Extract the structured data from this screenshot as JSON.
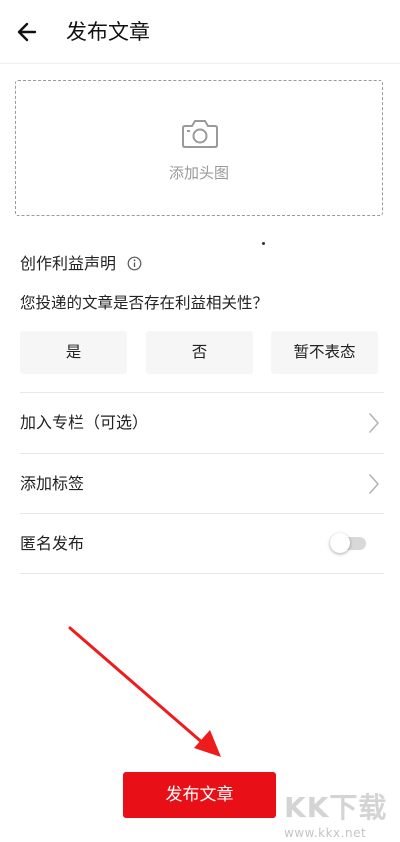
{
  "header": {
    "back_icon": "arrow-left-icon",
    "title": "发布文章"
  },
  "cover": {
    "icon": "camera-icon",
    "label": "添加头图"
  },
  "declaration": {
    "title": "创作利益声明",
    "info_icon": "info-icon",
    "question": "您投递的文章是否存在利益相关性？",
    "options": [
      "是",
      "否",
      "暂不表态"
    ]
  },
  "rows": [
    {
      "label": "加入专栏（可选）",
      "icon": "chevron-right-icon"
    },
    {
      "label": "添加标签",
      "icon": "chevron-right-icon"
    },
    {
      "label": "匿名发布",
      "toggle_on": false
    }
  ],
  "publish": {
    "label": "发布文章",
    "color": "#e80f16"
  },
  "annotation": {
    "color": "#ee1c1c"
  },
  "watermark": {
    "logo": "KK下载",
    "url": "www.kkx.net"
  }
}
